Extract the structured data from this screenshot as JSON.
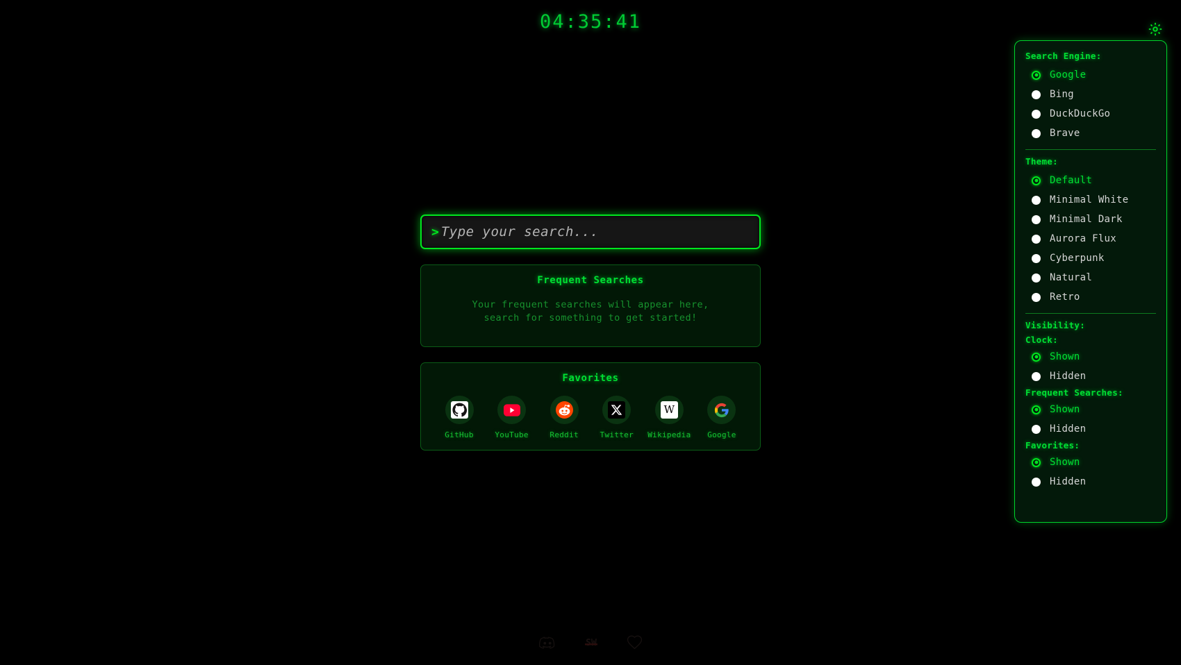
{
  "clock": {
    "time": "04:35:41"
  },
  "gear": {
    "icon": "gear-icon"
  },
  "search": {
    "prompt": ">",
    "value": "",
    "placeholder": "Type your search..."
  },
  "frequent": {
    "title": "Frequent Searches",
    "empty_line1": "Your frequent searches will appear here,",
    "empty_line2": "search for something to get started!"
  },
  "favorites": {
    "title": "Favorites",
    "items": [
      {
        "label": "GitHub",
        "icon": "github-icon"
      },
      {
        "label": "YouTube",
        "icon": "youtube-icon"
      },
      {
        "label": "Reddit",
        "icon": "reddit-icon"
      },
      {
        "label": "Twitter",
        "icon": "x-twitter-icon"
      },
      {
        "label": "Wikipedia",
        "icon": "wikipedia-icon"
      },
      {
        "label": "Google",
        "icon": "google-icon"
      }
    ]
  },
  "settings": {
    "search_engine": {
      "heading": "Search Engine:",
      "options": [
        "Google",
        "Bing",
        "DuckDuckGo",
        "Brave"
      ],
      "selected": "Google"
    },
    "theme": {
      "heading": "Theme:",
      "options": [
        "Default",
        "Minimal White",
        "Minimal Dark",
        "Aurora Flux",
        "Cyberpunk",
        "Natural",
        "Retro"
      ],
      "selected": "Default"
    },
    "visibility": {
      "heading": "Visibility:",
      "groups": [
        {
          "heading": "Clock:",
          "options": [
            "Shown",
            "Hidden"
          ],
          "selected": "Shown"
        },
        {
          "heading": "Frequent Searches:",
          "options": [
            "Shown",
            "Hidden"
          ],
          "selected": "Shown"
        },
        {
          "heading": "Favorites:",
          "options": [
            "Shown",
            "Hidden"
          ],
          "selected": "Shown"
        }
      ]
    }
  },
  "footer": {
    "items": [
      {
        "icon": "discord-icon"
      },
      {
        "icon": "sw-logo-icon"
      },
      {
        "icon": "heart-icon"
      }
    ]
  },
  "colors": {
    "accent": "#00e61f",
    "accent_text": "#00e033",
    "dim_green": "#17922e",
    "background": "#000000",
    "panel_bg": "#021806"
  }
}
